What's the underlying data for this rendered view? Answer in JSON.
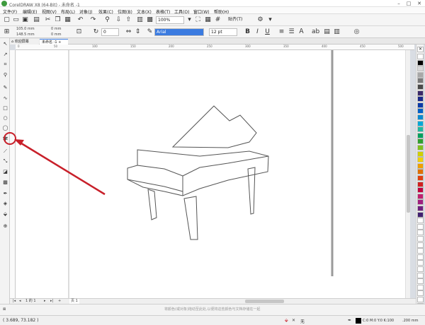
{
  "window": {
    "title": "CorelDRAW X8 (64-Bit) - 未命名 -1",
    "minimize": "–",
    "maximize": "□",
    "close": "✕"
  },
  "menu": [
    "文件(F)",
    "编辑(E)",
    "视图(V)",
    "布局(L)",
    "对象(J)",
    "效果(C)",
    "位图(B)",
    "文本(X)",
    "表格(T)",
    "工具(O)",
    "窗口(W)",
    "帮助(H)"
  ],
  "toolbar": {
    "zoom": "100%",
    "snap_label": "贴齐(T)"
  },
  "propbar": {
    "x_value": "105.0 mm",
    "y_value": "148.5 mm",
    "w_value": "0 mm",
    "h_value": "0 mm",
    "angle": "0",
    "font_name": "Arial",
    "font_size": "12 pt",
    "bold": "B",
    "italic": "I",
    "underline": "U"
  },
  "tabs": {
    "home": "欢迎屏幕",
    "doc": "未命名 -1"
  },
  "ruler": {
    "h_ticks": [
      "0",
      "50",
      "100",
      "150",
      "200",
      "250",
      "300",
      "350",
      "400",
      "450",
      "500"
    ]
  },
  "page": {
    "count": "1 的 1",
    "label": "页 1"
  },
  "docbar_hint": "将颜色(或对象)拖动至此处,以便将这些颜色与文档存储在一起",
  "status": {
    "coords": "( 3.689, 73.182 )",
    "fill_label": "无",
    "outline_label": "C:0 M:0 Y:0 K:100",
    "outline_width": ".200 mm"
  },
  "palette": [
    "#ffffff",
    "#000000",
    "#d8d8d8",
    "#a8a8a8",
    "#7a7a7a",
    "#4a4a4a",
    "#3a2a6a",
    "#1a2a8a",
    "#0a3aa8",
    "#0060c8",
    "#0a8ad0",
    "#00a8d8",
    "#20b8a0",
    "#00a060",
    "#30a030",
    "#80c020",
    "#d0d000",
    "#f0d000",
    "#f0a000",
    "#e07000",
    "#e04010",
    "#d02020",
    "#c00040",
    "#c02070",
    "#a02080",
    "#702080",
    "#402070",
    "#ffffff",
    "#ffffff",
    "#ffffff",
    "#ffffff",
    "#ffffff",
    "#ffffff",
    "#ffffff",
    "#ffffff",
    "#ffffff",
    "#ffffff",
    "#ffffff",
    "#ffffff",
    "#ffffff",
    "#ffffff",
    "#ffffff",
    "#ffffff"
  ],
  "colors": {
    "accent": "#3b7be0",
    "annotation": "#c8202a",
    "drawing": "#555555"
  }
}
